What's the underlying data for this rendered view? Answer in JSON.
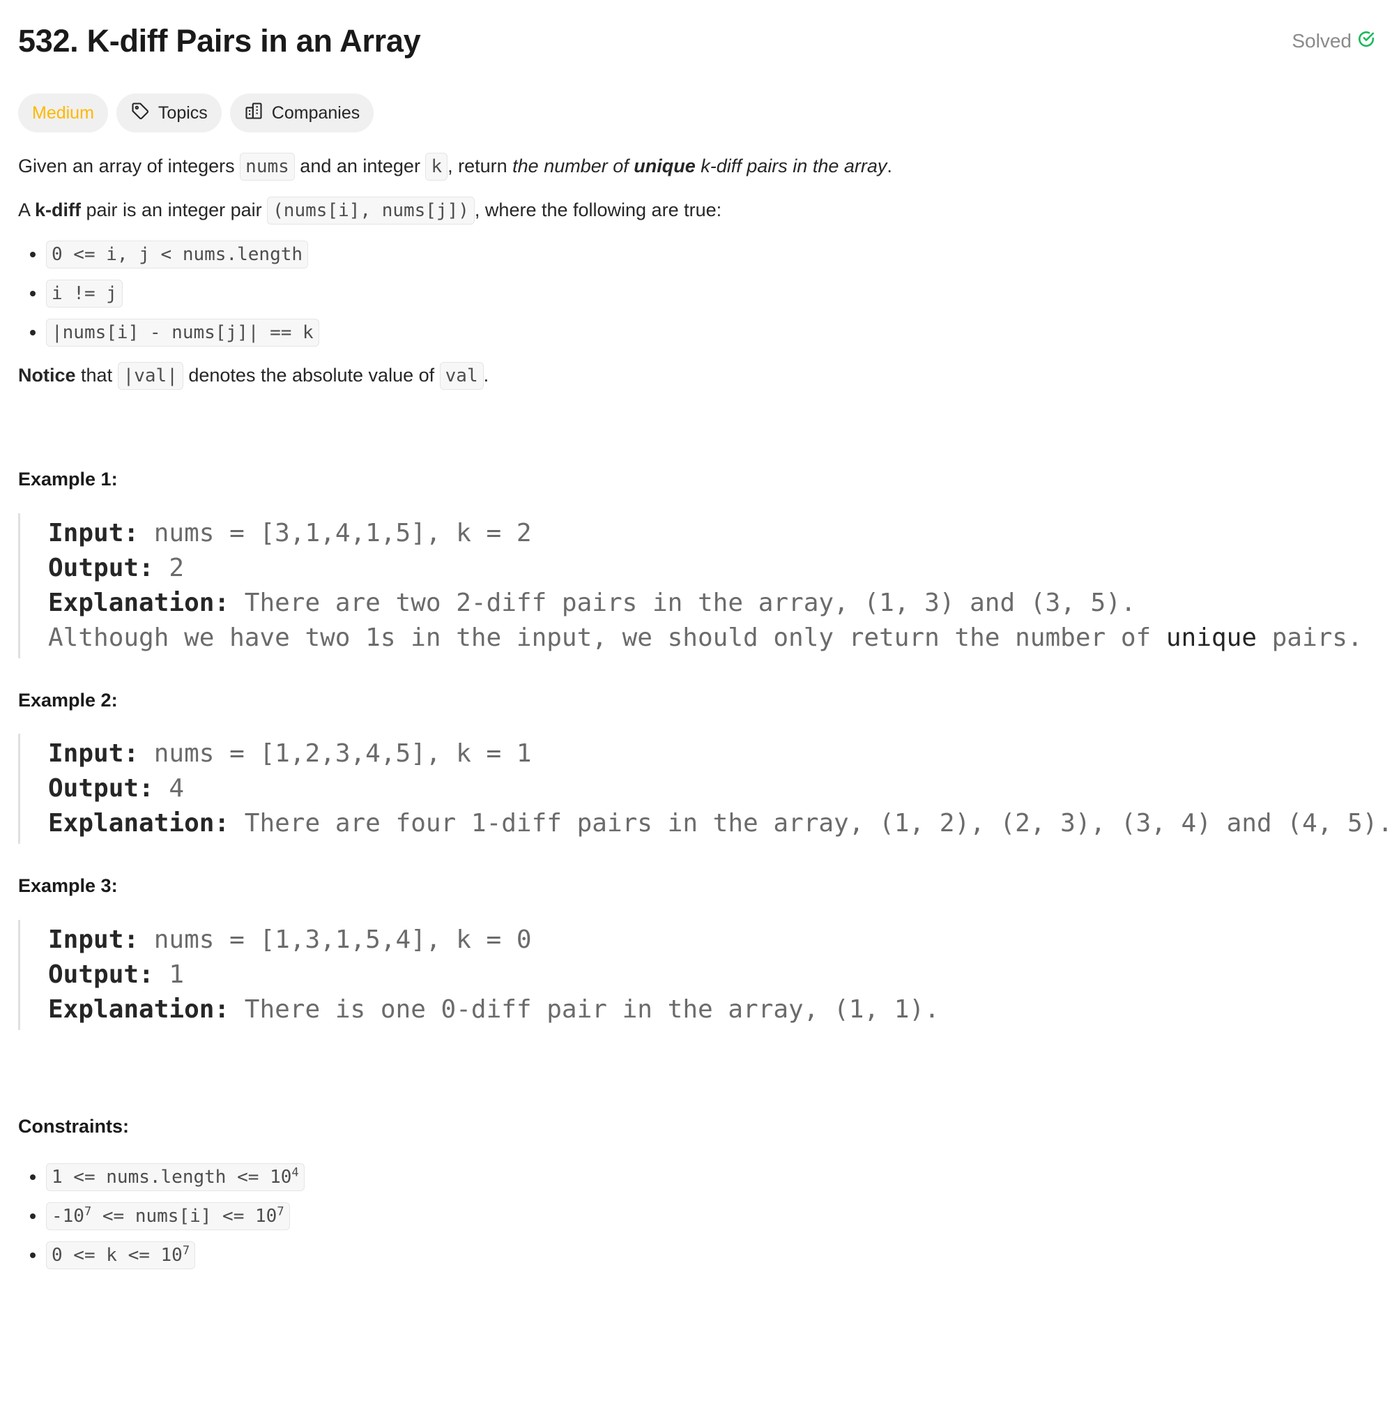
{
  "problem": {
    "title": "532. K-diff Pairs in an Array",
    "status": "Solved",
    "difficulty": "Medium",
    "topics_label": "Topics",
    "companies_label": "Companies"
  },
  "description": {
    "p1_a": "Given an array of integers ",
    "p1_code_nums": "nums",
    "p1_b": " and an integer ",
    "p1_code_k": "k",
    "p1_c": ", return ",
    "p1_em_a": "the number of ",
    "p1_em_strong": "unique",
    "p1_em_b": " k-diff pairs in the array",
    "p1_end": ".",
    "p2_a": "A ",
    "p2_strong": "k-diff",
    "p2_b": " pair is an integer pair ",
    "p2_code": "(nums[i], nums[j])",
    "p2_c": ", where the following are true:",
    "conditions": [
      "0 <= i, j < nums.length",
      "i != j",
      "|nums[i] - nums[j]| == k"
    ],
    "notice_strong": "Notice",
    "notice_a": " that ",
    "notice_code1": "|val|",
    "notice_b": " denotes the absolute value of ",
    "notice_code2": "val",
    "notice_end": "."
  },
  "examples": [
    {
      "title": "Example 1:",
      "input_label": "Input:",
      "input": "nums = [3,1,4,1,5], k = 2",
      "output_label": "Output:",
      "output": "2",
      "explanation_label": "Explanation:",
      "explanation": "There are two 2-diff pairs in the array, (1, 3) and (3, 5).",
      "extra_a": "Although we have two 1s in the input, we should only return the number of ",
      "extra_strong": "unique",
      "extra_b": " pairs."
    },
    {
      "title": "Example 2:",
      "input_label": "Input:",
      "input": "nums = [1,2,3,4,5], k = 1",
      "output_label": "Output:",
      "output": "4",
      "explanation_label": "Explanation:",
      "explanation": "There are four 1-diff pairs in the array, (1, 2), (2, 3), (3, 4) and (4, 5)."
    },
    {
      "title": "Example 3:",
      "input_label": "Input:",
      "input": "nums = [1,3,1,5,4], k = 0",
      "output_label": "Output:",
      "output": "1",
      "explanation_label": "Explanation:",
      "explanation": "There is one 0-diff pair in the array, (1, 1)."
    }
  ],
  "constraints": {
    "title": "Constraints:",
    "c1_a": "1 <= nums.length <= 10",
    "c1_sup": "4",
    "c2_a": "-10",
    "c2_sup1": "7",
    "c2_b": " <= nums[i] <= 10",
    "c2_sup2": "7",
    "c3_a": "0 <= k <= 10",
    "c3_sup": "7"
  },
  "colors": {
    "difficulty_medium": "#ffb800",
    "solved_check": "#1cb85c",
    "text": "#262626",
    "muted": "#8a8a8a",
    "tag_bg": "#f0f0f0"
  },
  "icons": [
    "check-circle-icon",
    "tag-icon",
    "building-icon"
  ]
}
